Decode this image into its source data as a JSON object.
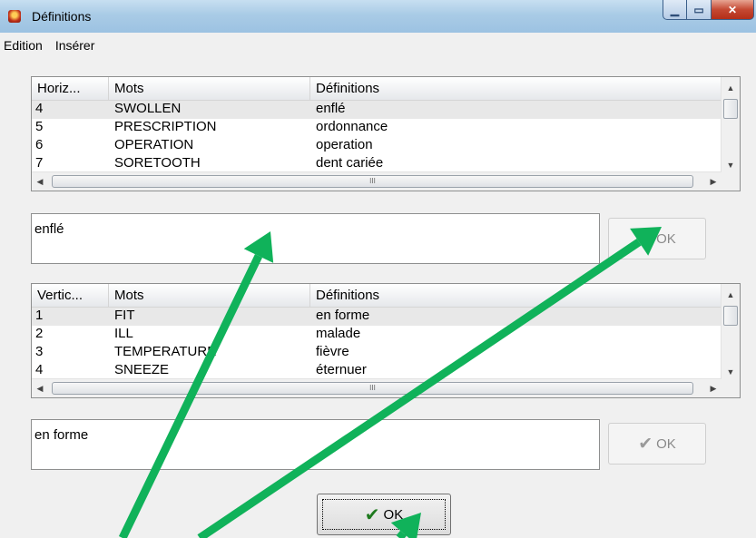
{
  "window": {
    "title": "Définitions"
  },
  "menu": {
    "items": [
      "Edition",
      "Insérer"
    ]
  },
  "horizontal": {
    "headers": [
      "Horiz...",
      "Mots",
      "Définitions"
    ],
    "rows": [
      [
        "4",
        "SWOLLEN",
        "enflé"
      ],
      [
        "5",
        "PRESCRIPTION",
        "ordonnance"
      ],
      [
        "6",
        "OPERATION",
        "operation"
      ],
      [
        "7",
        "SORETOOTH",
        "dent cariée"
      ]
    ],
    "definition": "enflé",
    "ok_label": "OK"
  },
  "vertical": {
    "headers": [
      "Vertic...",
      "Mots",
      "Définitions"
    ],
    "rows": [
      [
        "1",
        "FIT",
        "en forme"
      ],
      [
        "2",
        "ILL",
        "malade"
      ],
      [
        "3",
        "TEMPERATURE",
        "fièvre"
      ],
      [
        "4",
        "SNEEZE",
        "éternuer"
      ]
    ],
    "definition": "en forme",
    "ok_label": "OK"
  },
  "main_ok_label": "OK",
  "scroll_grip": "III",
  "colors": {
    "arrow": "#10b25a",
    "check_green": "#1e7a1e"
  }
}
